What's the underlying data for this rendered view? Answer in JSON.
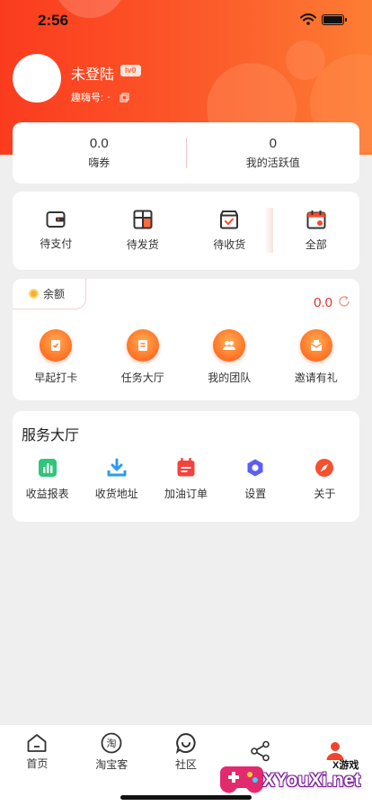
{
  "status_bar": {
    "time": "2:56"
  },
  "profile": {
    "name": "未登陆",
    "level": "lv0",
    "id_label": "趣嗨号:",
    "id_value": "-"
  },
  "stats": [
    {
      "value": "0.0",
      "label": "嗨券"
    },
    {
      "value": "0",
      "label": "我的活跃值"
    }
  ],
  "orders": [
    {
      "label": "待支付",
      "icon": "wallet-icon"
    },
    {
      "label": "待发货",
      "icon": "package-icon"
    },
    {
      "label": "待收货",
      "icon": "box-check-icon"
    },
    {
      "label": "全部",
      "icon": "calendar-icon"
    }
  ],
  "wallet": {
    "balance_label": "余额",
    "balance_value": "0.0",
    "items": [
      {
        "label": "早起打卡",
        "icon": "checkin-icon"
      },
      {
        "label": "任务大厅",
        "icon": "task-icon"
      },
      {
        "label": "我的团队",
        "icon": "team-icon"
      },
      {
        "label": "邀请有礼",
        "icon": "gift-mail-icon"
      }
    ]
  },
  "service": {
    "title": "服务大厅",
    "items": [
      {
        "label": "收益报表",
        "icon": "chart-icon"
      },
      {
        "label": "收货地址",
        "icon": "download-icon"
      },
      {
        "label": "加油订单",
        "icon": "fuel-calendar-icon"
      },
      {
        "label": "设置",
        "icon": "settings-icon"
      },
      {
        "label": "关于",
        "icon": "compass-icon"
      }
    ]
  },
  "tabbar": [
    {
      "label": "首页",
      "icon": "home-icon"
    },
    {
      "label": "淘宝客",
      "icon": "taobao-icon",
      "glyph": "淘"
    },
    {
      "label": "社区",
      "icon": "chat-icon"
    },
    {
      "label": "",
      "icon": "share-icon"
    },
    {
      "label": "",
      "icon": "user-icon"
    }
  ],
  "watermark": {
    "text": "XYouXi.net",
    "sub": "X游戏"
  },
  "colors": {
    "brand_red": "#fb3b1e",
    "brand_orange": "#fd7d33",
    "balance_red": "#e8312a"
  }
}
